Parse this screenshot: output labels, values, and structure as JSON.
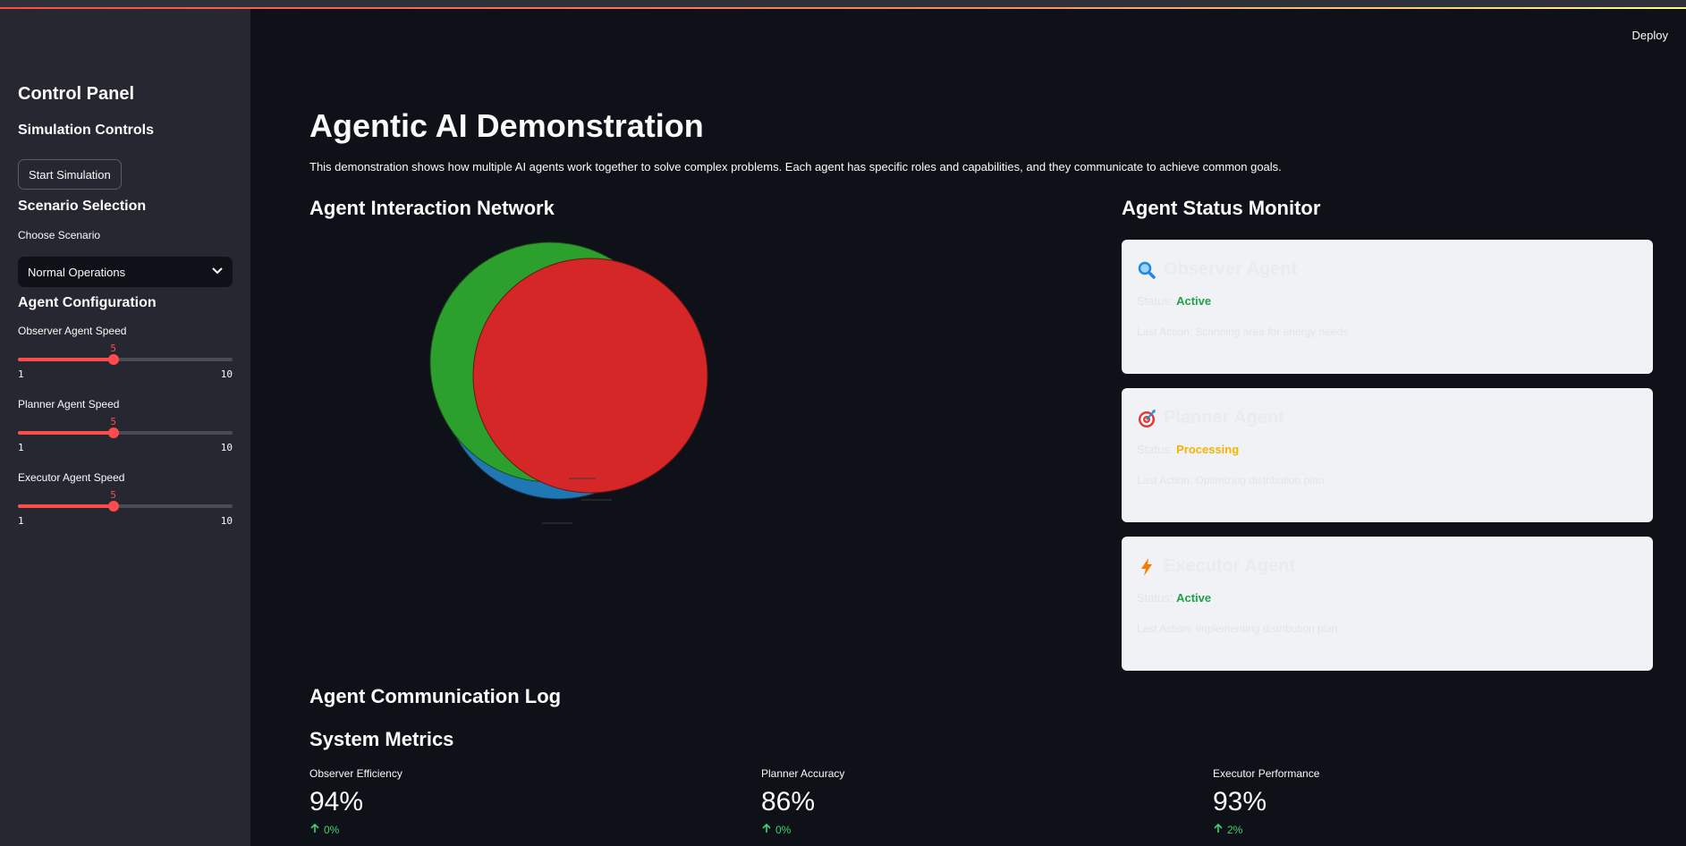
{
  "header": {
    "deploy_label": "Deploy"
  },
  "sidebar": {
    "title": "Control Panel",
    "simulation": {
      "heading": "Simulation Controls",
      "start_button": "Start Simulation"
    },
    "scenario": {
      "heading": "Scenario Selection",
      "label": "Choose Scenario",
      "selected": "Normal Operations"
    },
    "config": {
      "heading": "Agent Configuration",
      "sliders": [
        {
          "label": "Observer Agent Speed",
          "value": 5,
          "min": 1,
          "max": 10
        },
        {
          "label": "Planner Agent Speed",
          "value": 5,
          "min": 1,
          "max": 10
        },
        {
          "label": "Executor Agent Speed",
          "value": 5,
          "min": 1,
          "max": 10
        }
      ]
    }
  },
  "main": {
    "title": "Agentic AI Demonstration",
    "description": "This demonstration shows how multiple AI agents work together to solve complex problems. Each agent has specific roles and capabilities, and they communicate to achieve common goals.",
    "network_heading": "Agent Interaction Network",
    "status_heading": "Agent Status Monitor",
    "log_heading": "Agent Communication Log",
    "metrics_heading": "System Metrics",
    "network_colors": {
      "blue": "#1f77b4",
      "green": "#2ca02c",
      "red": "#d62728"
    }
  },
  "agents": [
    {
      "icon": "magnifier-icon",
      "name": "Observer Agent",
      "status_label": "Status:",
      "status": "Active",
      "status_color": "#21a148",
      "action": "Last Action: Scanning area for energy needs"
    },
    {
      "icon": "target-icon",
      "name": "Planner Agent",
      "status_label": "Status:",
      "status": "Processing",
      "status_color": "#f5b400",
      "action": "Last Action: Optimizing distribution plan"
    },
    {
      "icon": "lightning-icon",
      "name": "Executor Agent",
      "status_label": "Status:",
      "status": "Active",
      "status_color": "#21a148",
      "action": "Last Action: Implementing distribution plan"
    }
  ],
  "metrics": [
    {
      "label": "Observer Efficiency",
      "value": "94%",
      "delta": "0%"
    },
    {
      "label": "Planner Accuracy",
      "value": "86%",
      "delta": "0%"
    },
    {
      "label": "Executor Performance",
      "value": "93%",
      "delta": "2%"
    }
  ]
}
